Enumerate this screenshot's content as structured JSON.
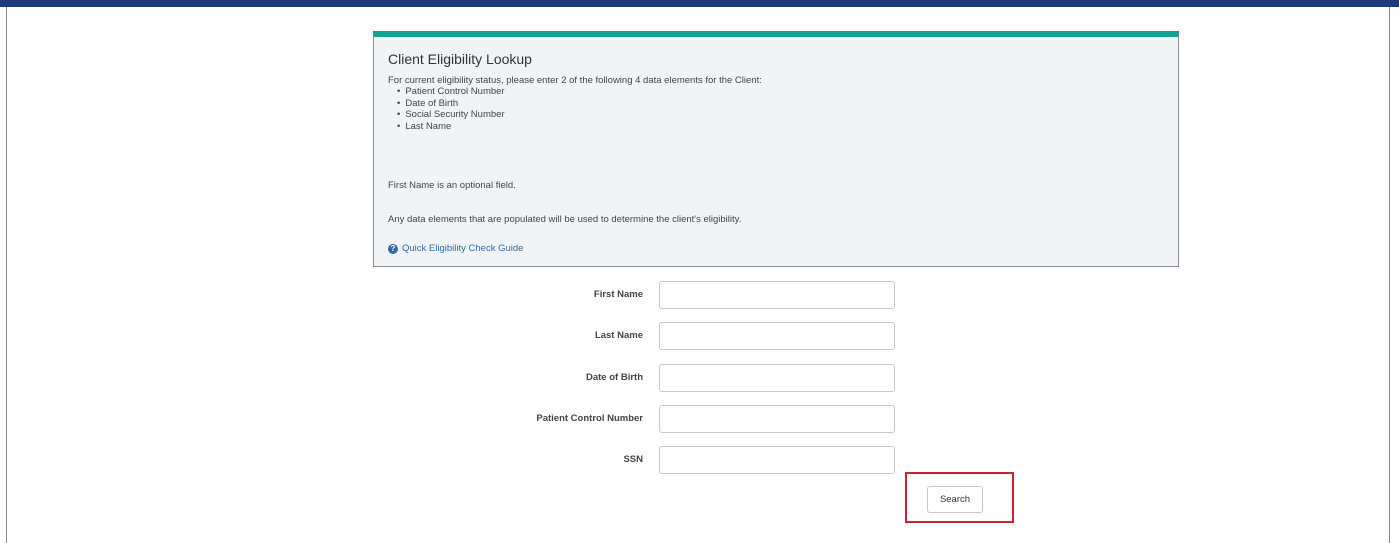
{
  "panel": {
    "title": "Client Eligibility Lookup",
    "intro": "For current eligibility status, please enter 2 of the following 4 data elements for the Client:",
    "elements": [
      "Patient Control Number",
      "Date of Birth",
      "Social Security Number",
      "Last Name"
    ],
    "optional_note": "First Name is an optional field.",
    "populated_note": "Any data elements that are populated will be used to determine the client's eligibility.",
    "guide_link": "Quick Eligibility Check Guide",
    "guide_icon": "question-circle-icon",
    "accent_color": "#14a393"
  },
  "form": {
    "first_name_label": "First Name",
    "first_name_value": "",
    "last_name_label": "Last Name",
    "last_name_value": "",
    "dob_label": "Date of Birth",
    "dob_value": "",
    "pcn_label": "Patient Control Number",
    "pcn_value": "",
    "ssn_label": "SSN",
    "ssn_value": "",
    "search_label": "Search",
    "highlight_color": "#c8242b"
  },
  "header": {
    "bar_color": "#1f3a7a"
  }
}
